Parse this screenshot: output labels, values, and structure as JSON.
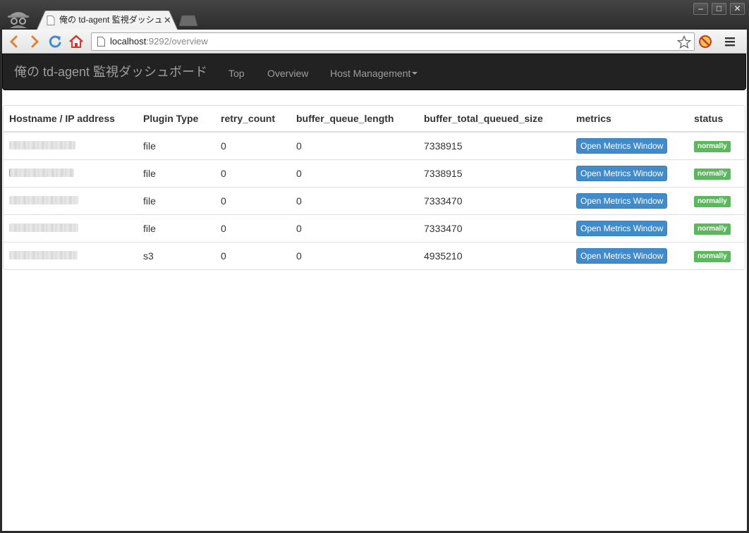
{
  "browser": {
    "tab": {
      "title": "俺の td-agent 監視ダッシュボード"
    },
    "omnibox": {
      "host": "localhost",
      "path": ":9292/overview"
    }
  },
  "navbar": {
    "brand": "俺の td-agent 監視ダッシュボード",
    "links": [
      "Top",
      "Overview",
      "Host Management"
    ]
  },
  "table": {
    "headers": [
      "Hostname / IP address",
      "Plugin Type",
      "retry_count",
      "buffer_queue_length",
      "buffer_total_queued_size",
      "metrics",
      "status"
    ],
    "rows": [
      {
        "plugin_type": "file",
        "retry_count": "0",
        "buffer_queue_length": "0",
        "buffer_total_queued_size": "7338915",
        "metrics_label": "Open Metrics Window",
        "status": "normally"
      },
      {
        "plugin_type": "file",
        "retry_count": "0",
        "buffer_queue_length": "0",
        "buffer_total_queued_size": "7338915",
        "metrics_label": "Open Metrics Window",
        "status": "normally"
      },
      {
        "plugin_type": "file",
        "retry_count": "0",
        "buffer_queue_length": "0",
        "buffer_total_queued_size": "7333470",
        "metrics_label": "Open Metrics Window",
        "status": "normally"
      },
      {
        "plugin_type": "file",
        "retry_count": "0",
        "buffer_queue_length": "0",
        "buffer_total_queued_size": "7333470",
        "metrics_label": "Open Metrics Window",
        "status": "normally"
      },
      {
        "plugin_type": "s3",
        "retry_count": "0",
        "buffer_queue_length": "0",
        "buffer_total_queued_size": "4935210",
        "metrics_label": "Open Metrics Window",
        "status": "normally"
      }
    ]
  },
  "colors": {
    "navbar_bg": "#222222",
    "primary": "#428bca",
    "success": "#5cb85c"
  },
  "icons": [
    "incognito-icon",
    "page-icon",
    "close-icon",
    "back-icon",
    "forward-icon",
    "reload-icon",
    "home-icon",
    "star-icon",
    "extension-icon",
    "menu-icon",
    "caret-down-icon"
  ]
}
